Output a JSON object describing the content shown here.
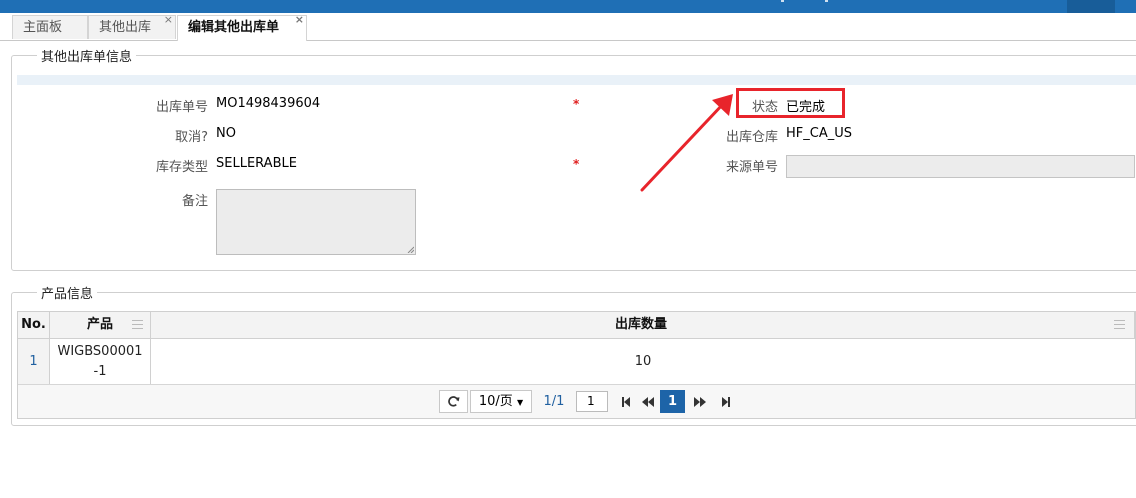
{
  "tabs": [
    {
      "label": "主面板",
      "closable": false,
      "active": false
    },
    {
      "label": "其他出库",
      "closable": true,
      "active": false
    },
    {
      "label": "编辑其他出库单",
      "closable": true,
      "active": true
    }
  ],
  "close_glyph": "×",
  "order_info": {
    "legend": "其他出库单信息",
    "fields": {
      "order_no": {
        "label": "出库单号",
        "value": "MO1498439604",
        "required": true
      },
      "cancelled": {
        "label": "取消?",
        "value": "NO"
      },
      "stock_type": {
        "label": "库存类型",
        "value": "SELLERABLE",
        "required": true
      },
      "remark": {
        "label": "备注",
        "value": ""
      },
      "status": {
        "label": "状态",
        "value": "已完成"
      },
      "warehouse": {
        "label": "出库仓库",
        "value": "HF_CA_US"
      },
      "source_no": {
        "label": "来源单号",
        "value": ""
      }
    },
    "required_mark": "*"
  },
  "annotation": {
    "color": "#e8242b",
    "target": "status"
  },
  "product_info": {
    "legend": "产品信息",
    "columns": [
      "No.",
      "产品",
      "出库数量"
    ],
    "rows": [
      {
        "no": "1",
        "product_line1": "WIGBS00001",
        "product_line2": "-1",
        "quantity": "10"
      }
    ],
    "pager": {
      "page_size": "10/页",
      "page_info": "1/1",
      "page_input": "1",
      "current_page": "1"
    }
  },
  "colors": {
    "header_bar": "#1f6fb5",
    "current_page": "#1d64a8",
    "required": "#e02020"
  }
}
